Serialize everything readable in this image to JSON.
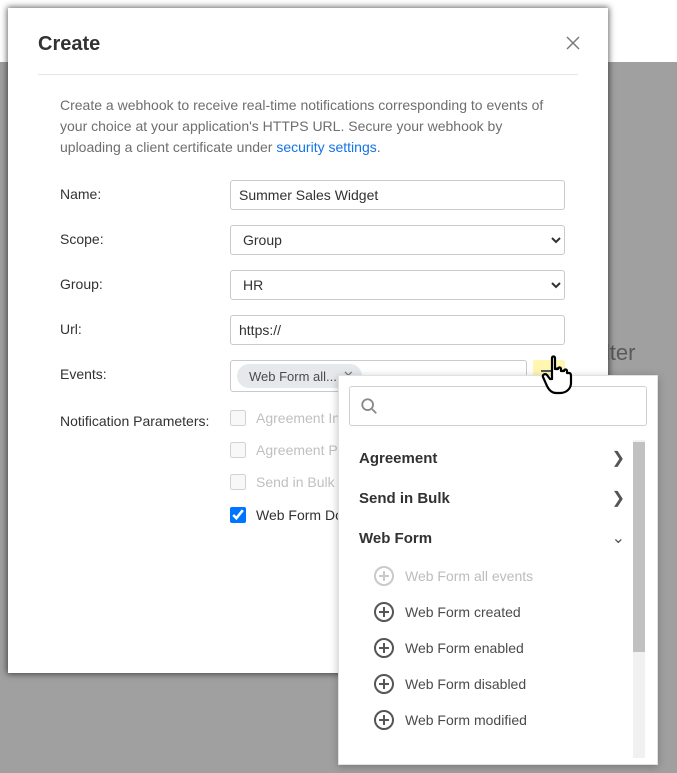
{
  "background": {
    "filter_text": "ilter"
  },
  "modal": {
    "title": "Create",
    "description": {
      "text_before_link": "Create a webhook to receive real-time notifications corresponding to events of your choice at your application's HTTPS URL. Secure your webhook by uploading a client certificate under ",
      "link_text": "security settings",
      "text_after_link": "."
    },
    "labels": {
      "name": "Name:",
      "scope": "Scope:",
      "group": "Group:",
      "url": "Url:",
      "events": "Events:",
      "notification_parameters": "Notification Parameters:"
    },
    "fields": {
      "name_value": "Summer Sales Widget",
      "scope_value": "Group",
      "group_value": "HR",
      "url_value": "https://",
      "event_chip": "Web Form all..."
    },
    "notification_options": [
      {
        "label": "Agreement In",
        "checked": false,
        "disabled": true
      },
      {
        "label": "Agreement Pa Info",
        "checked": false,
        "disabled": true
      },
      {
        "label": "Send in Bulk In",
        "checked": false,
        "disabled": true
      },
      {
        "label": "Web Form Do Info",
        "checked": true,
        "disabled": false
      }
    ]
  },
  "dropdown": {
    "search_placeholder": "",
    "categories": [
      {
        "label": "Agreement",
        "expanded": false
      },
      {
        "label": "Send in Bulk",
        "expanded": false
      },
      {
        "label": "Web Form",
        "expanded": true
      }
    ],
    "web_form_items": [
      {
        "label": "Web Form all events",
        "disabled": true
      },
      {
        "label": "Web Form created",
        "disabled": false
      },
      {
        "label": "Web Form enabled",
        "disabled": false
      },
      {
        "label": "Web Form disabled",
        "disabled": false
      },
      {
        "label": "Web Form modified",
        "disabled": false
      }
    ]
  }
}
